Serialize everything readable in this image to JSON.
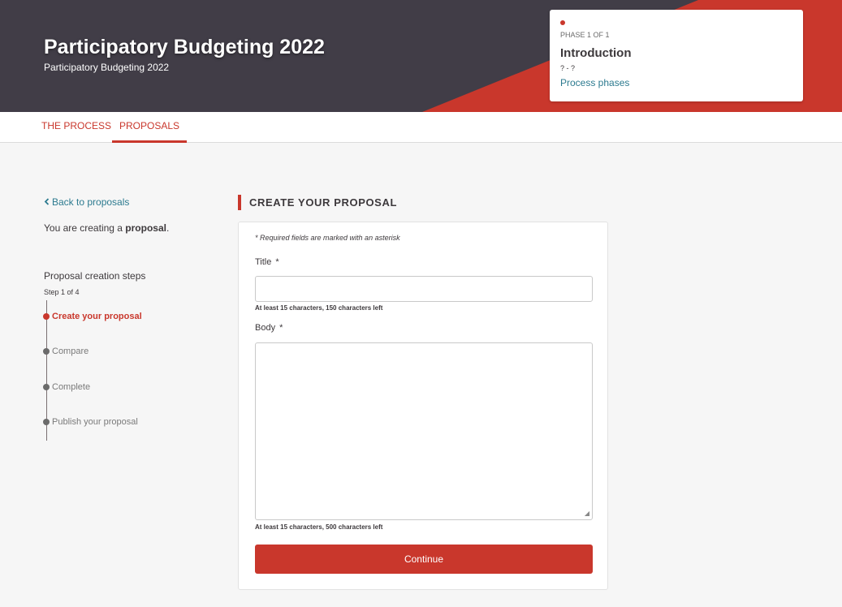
{
  "hero": {
    "title": "Participatory Budgeting 2022",
    "subtitle": "Participatory Budgeting 2022",
    "background_color": "#413d47",
    "accent_color": "#c9372c"
  },
  "phase": {
    "label": "PHASE 1 OF 1",
    "title": "Introduction",
    "dates": "? - ?",
    "link": "Process phases"
  },
  "tabs": [
    {
      "label": "THE PROCESS",
      "active": false
    },
    {
      "label": "PROPOSALS",
      "active": true
    }
  ],
  "sidebar": {
    "back_link": "Back to proposals",
    "back_icon": "chevron-left-icon",
    "creating_prefix": "You are creating a ",
    "creating_type": "proposal",
    "creating_suffix": ".",
    "steps_title": "Proposal creation steps",
    "steps_count": "Step 1 of 4",
    "steps": [
      {
        "label": "Create your proposal",
        "active": true
      },
      {
        "label": "Compare",
        "active": false
      },
      {
        "label": "Complete",
        "active": false
      },
      {
        "label": "Publish your proposal",
        "active": false
      }
    ]
  },
  "form": {
    "heading": "CREATE YOUR PROPOSAL",
    "required_note": "* Required fields are marked with an asterisk",
    "title_label": "Title",
    "title_required": "*",
    "title_value": "",
    "title_help": "At least 15 characters, 150 characters left",
    "body_label": "Body",
    "body_required": "*",
    "body_value": "",
    "body_help": "At least 15 characters, 500 characters left",
    "continue_label": "Continue"
  }
}
